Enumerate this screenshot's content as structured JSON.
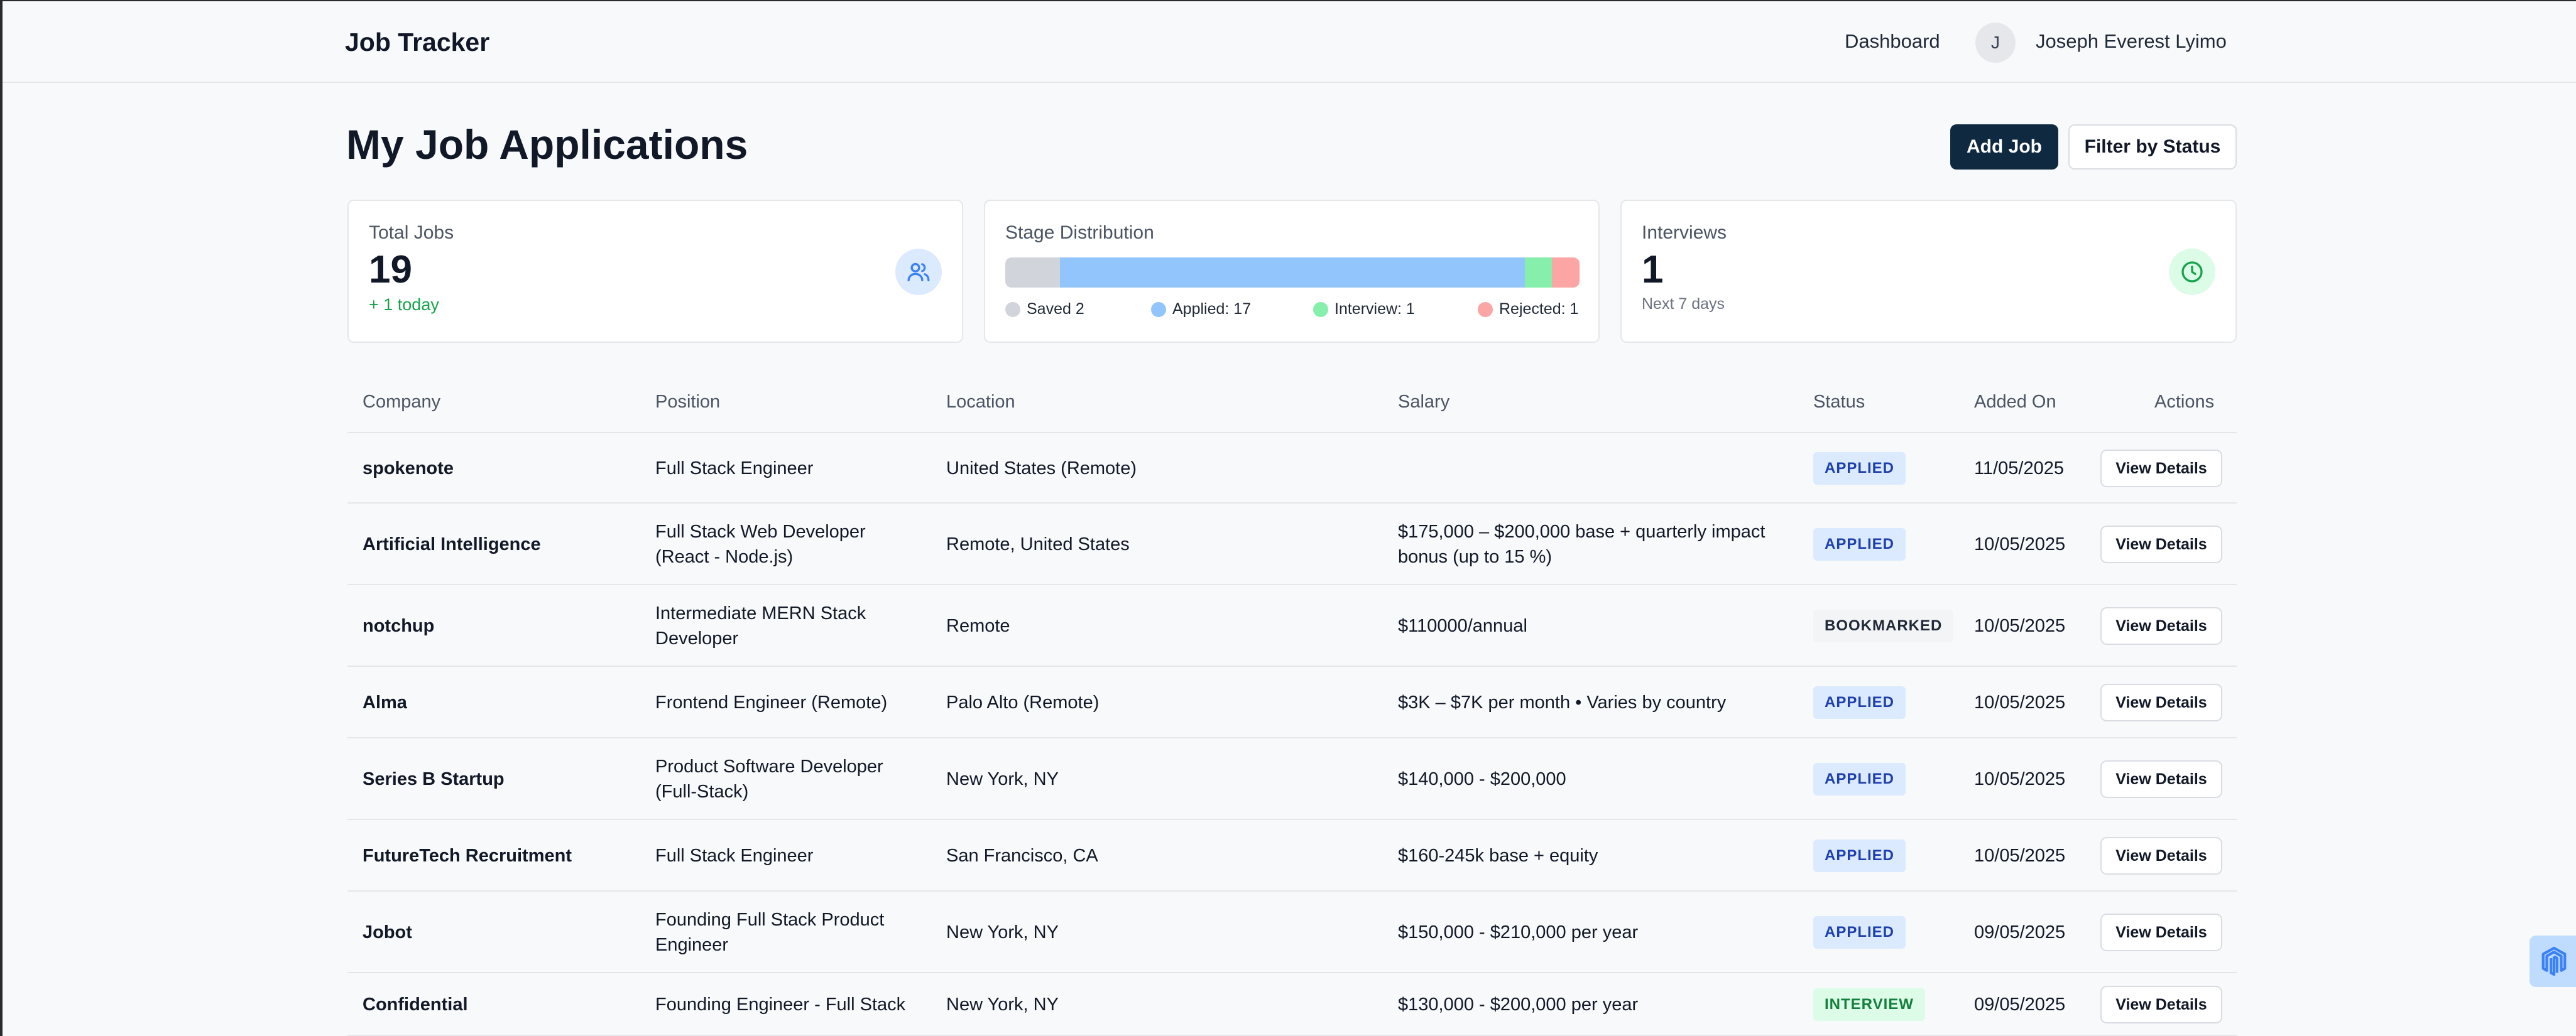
{
  "header": {
    "brand": "Job Tracker",
    "nav_dashboard": "Dashboard",
    "avatar_initial": "J",
    "user_name": "Joseph Everest Lyimo"
  },
  "page": {
    "title": "My Job Applications",
    "add_job_label": "Add Job",
    "filter_label": "Filter by Status"
  },
  "stats": {
    "total": {
      "label": "Total Jobs",
      "value": "19",
      "sub": "+ 1 today",
      "icon": "users-icon"
    },
    "stages": {
      "label": "Stage Distribution",
      "segments": [
        {
          "name": "Saved",
          "count": 2,
          "color": "#d1d5db",
          "legend": "Saved 2"
        },
        {
          "name": "Applied",
          "count": 17,
          "color": "#93c5fd",
          "legend": "Applied: 17"
        },
        {
          "name": "Interview",
          "count": 1,
          "color": "#86efac",
          "legend": "Interview: 1"
        },
        {
          "name": "Rejected",
          "count": 1,
          "color": "#fca5a5",
          "legend": "Rejected: 1"
        }
      ]
    },
    "interviews": {
      "label": "Interviews",
      "value": "1",
      "sub": "Next 7 days",
      "icon": "clock-icon"
    }
  },
  "table": {
    "columns": [
      "Company",
      "Position",
      "Location",
      "Salary",
      "Status",
      "Added On",
      "Actions"
    ],
    "action_label": "View Details",
    "rows": [
      {
        "company": "spokenote",
        "position": [
          "Full Stack Engineer"
        ],
        "location": "United States (Remote)",
        "salary": [
          ""
        ],
        "status": "APPLIED",
        "status_kind": "applied",
        "added": "11/05/2025"
      },
      {
        "company": "Artificial Intelligence",
        "position": [
          "Full Stack Web Developer",
          "(React - Node.js)"
        ],
        "location": "Remote, United States",
        "salary": [
          "$175,000 – $200,000 base + quarterly impact",
          "bonus (up to 15 %)"
        ],
        "status": "APPLIED",
        "status_kind": "applied",
        "added": "10/05/2025"
      },
      {
        "company": "notchup",
        "position": [
          "Intermediate MERN Stack",
          "Developer"
        ],
        "location": "Remote",
        "salary": [
          "$110000/annual"
        ],
        "status": "BOOKMARKED",
        "status_kind": "bookmarked",
        "added": "10/05/2025"
      },
      {
        "company": "Alma",
        "position": [
          "Frontend Engineer (Remote)"
        ],
        "location": "Palo Alto (Remote)",
        "salary": [
          "$3K – $7K per month • Varies by country"
        ],
        "status": "APPLIED",
        "status_kind": "applied",
        "added": "10/05/2025"
      },
      {
        "company": "Series B Startup",
        "position": [
          "Product Software Developer",
          "(Full-Stack)"
        ],
        "location": "New York, NY",
        "salary": [
          "$140,000 - $200,000"
        ],
        "status": "APPLIED",
        "status_kind": "applied",
        "added": "10/05/2025"
      },
      {
        "company": "FutureTech Recruitment",
        "position": [
          "Full Stack Engineer"
        ],
        "location": "San Francisco, CA",
        "salary": [
          "$160-245k base + equity"
        ],
        "status": "APPLIED",
        "status_kind": "applied",
        "added": "10/05/2025"
      },
      {
        "company": "Jobot",
        "position": [
          "Founding Full Stack Product",
          "Engineer"
        ],
        "location": "New York, NY",
        "salary": [
          "$150,000 - $210,000 per year"
        ],
        "status": "APPLIED",
        "status_kind": "applied",
        "added": "09/05/2025"
      },
      {
        "company": "Confidential",
        "position": [
          "Founding Engineer - Full Stack"
        ],
        "location": "New York, NY",
        "salary": [
          "$130,000 - $200,000 per year"
        ],
        "status": "INTERVIEW",
        "status_kind": "interview",
        "added": "09/05/2025"
      }
    ]
  },
  "widget": {
    "icon": "magento-icon"
  }
}
